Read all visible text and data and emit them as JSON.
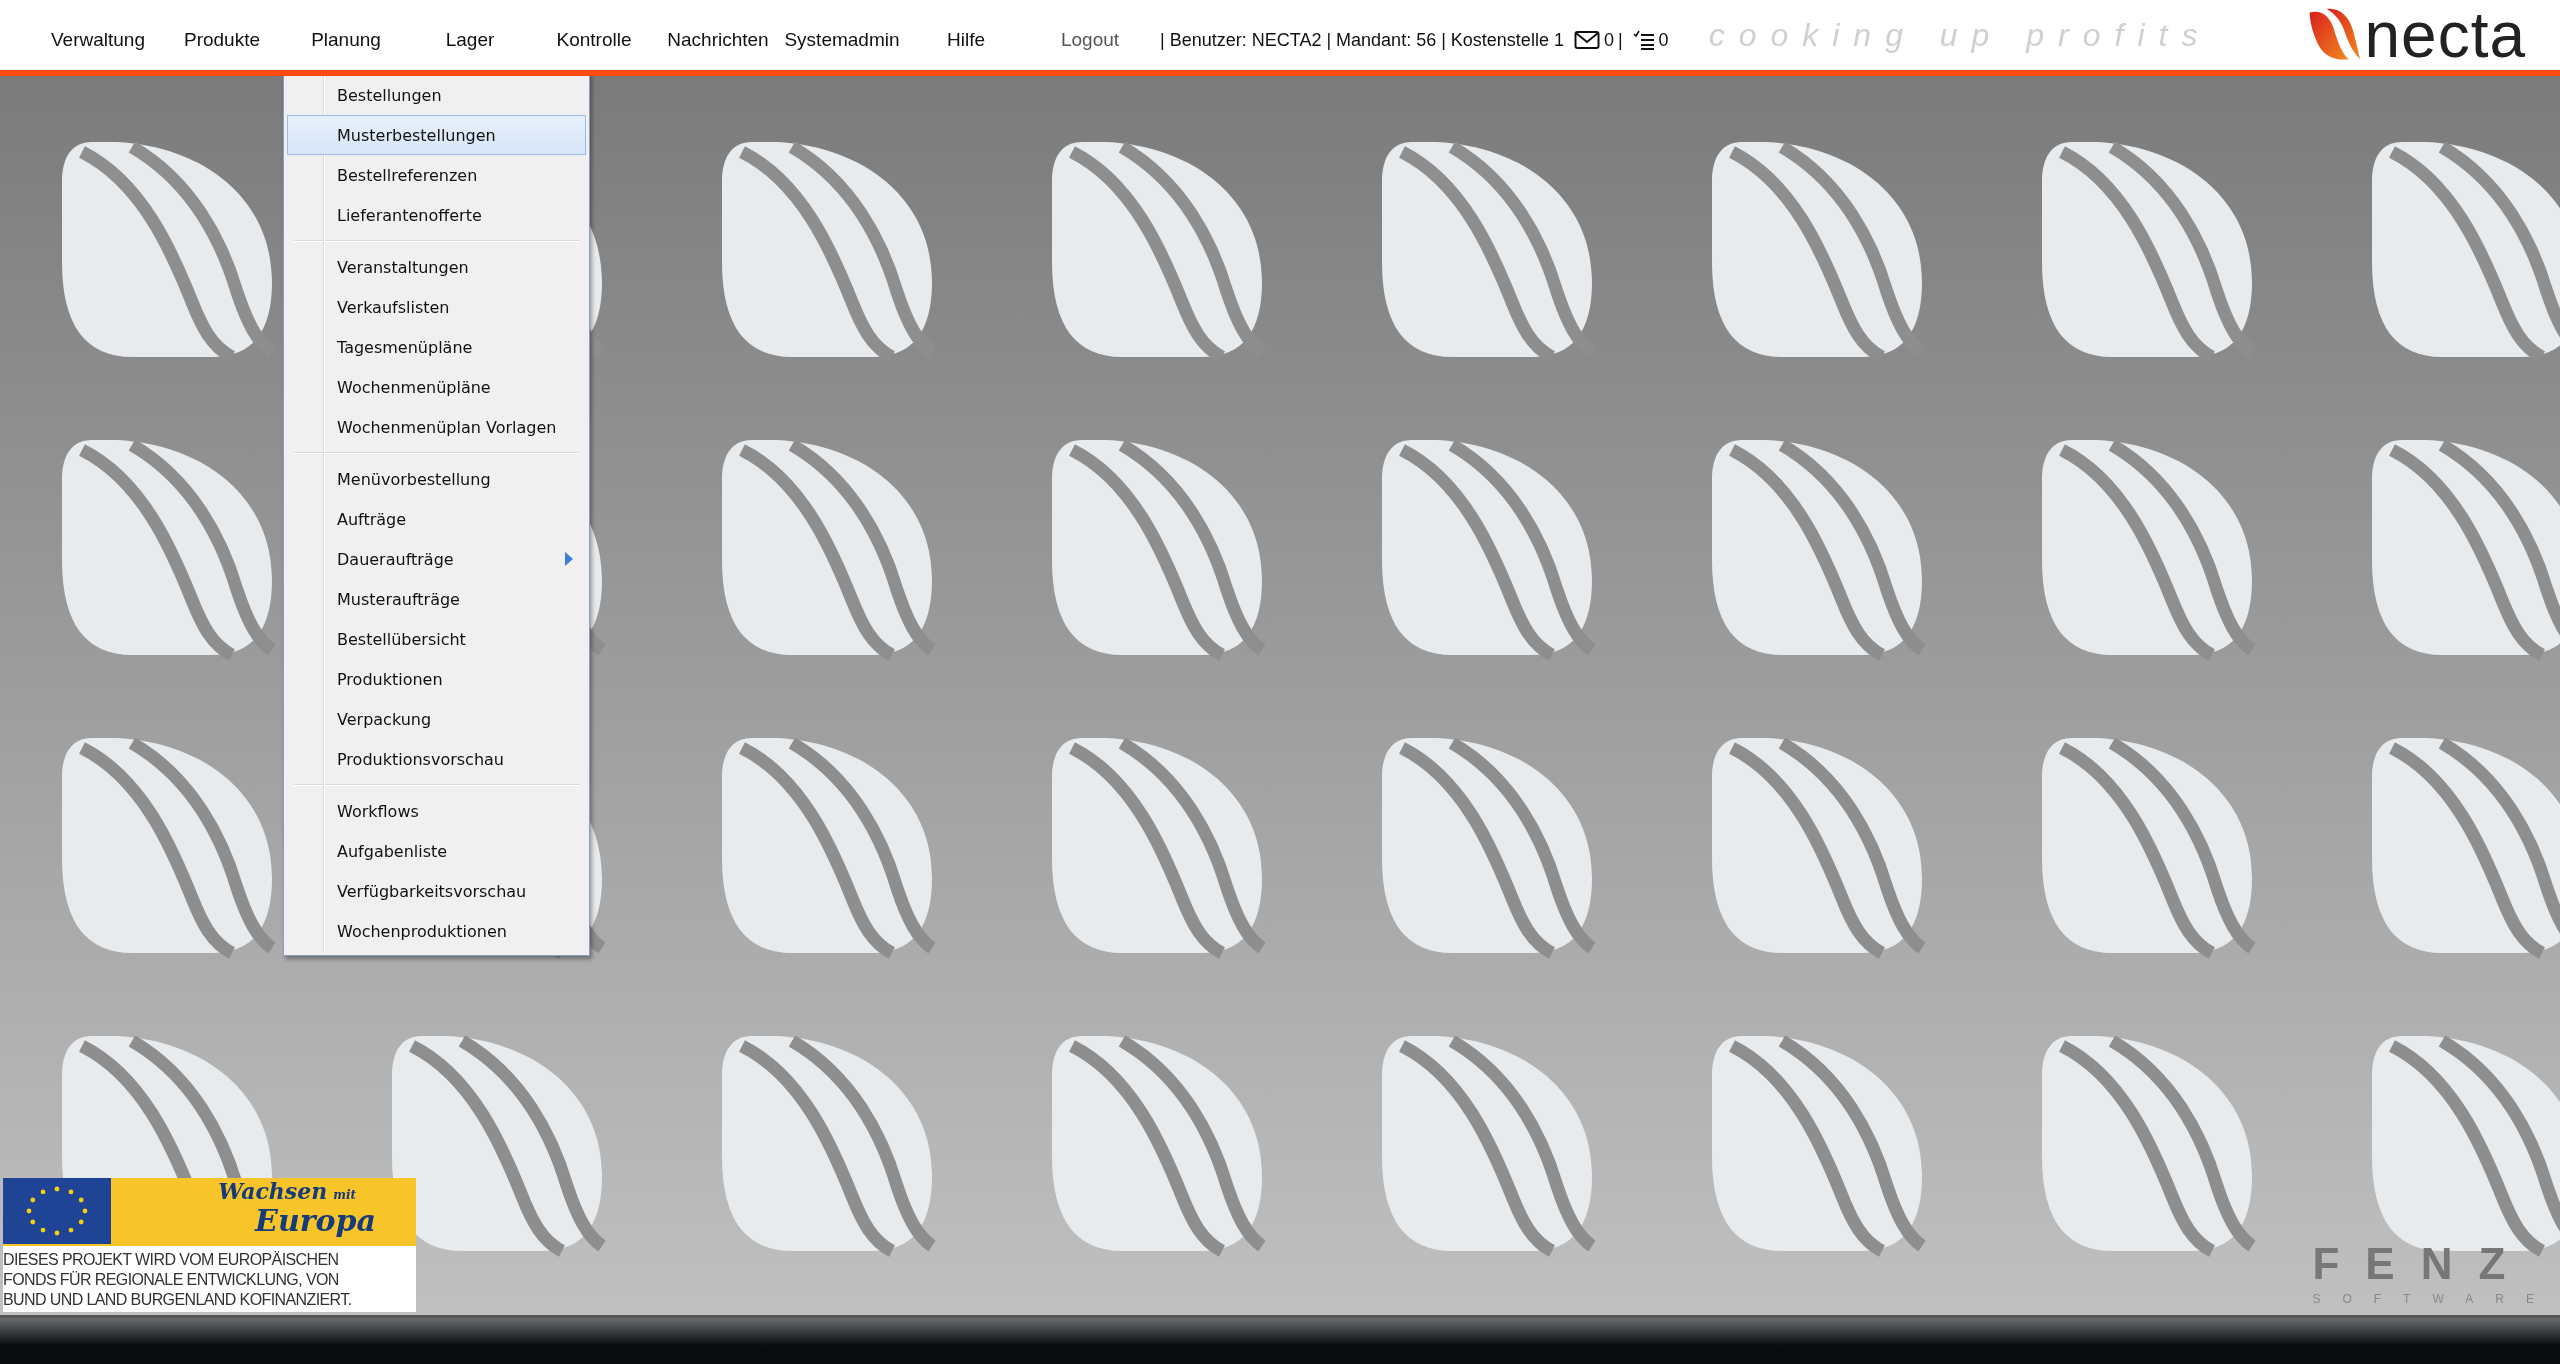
{
  "menu_bar": {
    "items": [
      {
        "label": "Verwaltung"
      },
      {
        "label": "Produkte"
      },
      {
        "label": "Planung"
      },
      {
        "label": "Lager"
      },
      {
        "label": "Kontrolle"
      },
      {
        "label": "Nachrichten"
      },
      {
        "label": "Systemadmin"
      },
      {
        "label": "Hilfe"
      }
    ],
    "logout": "Logout",
    "user_info": "| Benutzer: NECTA2 | Mandant: 56 | Kostenstelle 1",
    "messages_count": "0",
    "divider": "|",
    "tasks_count": "0"
  },
  "tagline": "cooking up profits",
  "logo": "necta",
  "dropdown": {
    "groups": [
      [
        {
          "label": "Bestellungen",
          "kind": "item",
          "selected": false
        },
        {
          "label": "Musterbestellungen",
          "kind": "item",
          "selected": true
        },
        {
          "label": "Bestellreferenzen",
          "kind": "item",
          "selected": false
        },
        {
          "label": "Lieferantenofferte",
          "kind": "item",
          "selected": false
        }
      ],
      [
        {
          "label": "Veranstaltungen",
          "kind": "item",
          "selected": false
        },
        {
          "label": "Verkaufslisten",
          "kind": "item",
          "selected": false
        },
        {
          "label": "Tagesmenüpläne",
          "kind": "item",
          "selected": false
        },
        {
          "label": "Wochenmenüpläne",
          "kind": "item",
          "selected": false
        },
        {
          "label": "Wochenmenüplan Vorlagen",
          "kind": "item",
          "selected": false
        }
      ],
      [
        {
          "label": "Menüvorbestellung",
          "kind": "item",
          "selected": false
        },
        {
          "label": "Aufträge",
          "kind": "item",
          "selected": false
        },
        {
          "label": "Daueraufträge",
          "kind": "submenu",
          "selected": false
        },
        {
          "label": "Musteraufträge",
          "kind": "item",
          "selected": false
        },
        {
          "label": "Bestellübersicht",
          "kind": "item",
          "selected": false
        },
        {
          "label": "Produktionen",
          "kind": "item",
          "selected": false
        },
        {
          "label": "Verpackung",
          "kind": "item",
          "selected": false
        },
        {
          "label": "Produktionsvorschau",
          "kind": "item",
          "selected": false
        }
      ],
      [
        {
          "label": "Workflows",
          "kind": "item",
          "selected": false
        },
        {
          "label": "Aufgabenliste",
          "kind": "item",
          "selected": false
        },
        {
          "label": "Verfügbarkeitsvorschau",
          "kind": "item",
          "selected": false
        },
        {
          "label": "Wochenproduktionen",
          "kind": "item",
          "selected": false
        }
      ]
    ]
  },
  "eu_banner": {
    "title": "Wachsen",
    "title_small": "mit",
    "title_large": "Europa",
    "lines": [
      "DIESES PROJEKT WIRD  VOM EUROPÄISCHEN",
      "FONDS FÜR REGIONALE ENTWICKLUNG,  VON",
      "BUND UND LAND BURGENLAND KOFINANZIERT."
    ]
  },
  "footer_logo": {
    "name": "FENZ",
    "subtitle": "SOFTWARE"
  }
}
